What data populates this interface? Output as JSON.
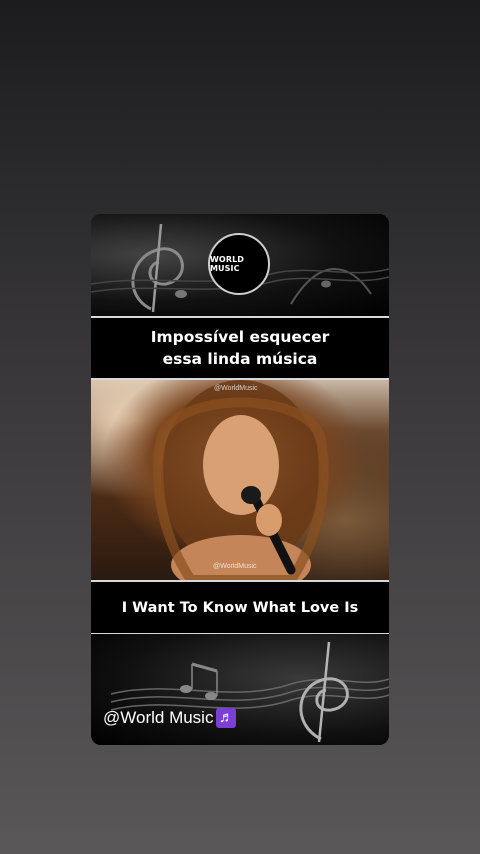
{
  "logo": {
    "text": "WORLD MUSIC"
  },
  "caption": {
    "line1": "Impossível esquecer",
    "line2": "essa linda música"
  },
  "video": {
    "watermark_top": "@WorldMusic",
    "watermark_bottom": "@WorldMusic"
  },
  "song": {
    "title": "I Want To Know What Love Is"
  },
  "footer": {
    "handle": "@World Music",
    "icon": "music-note-icon",
    "icon_glyph": "♬",
    "icon_color": "#7b3fd6"
  }
}
